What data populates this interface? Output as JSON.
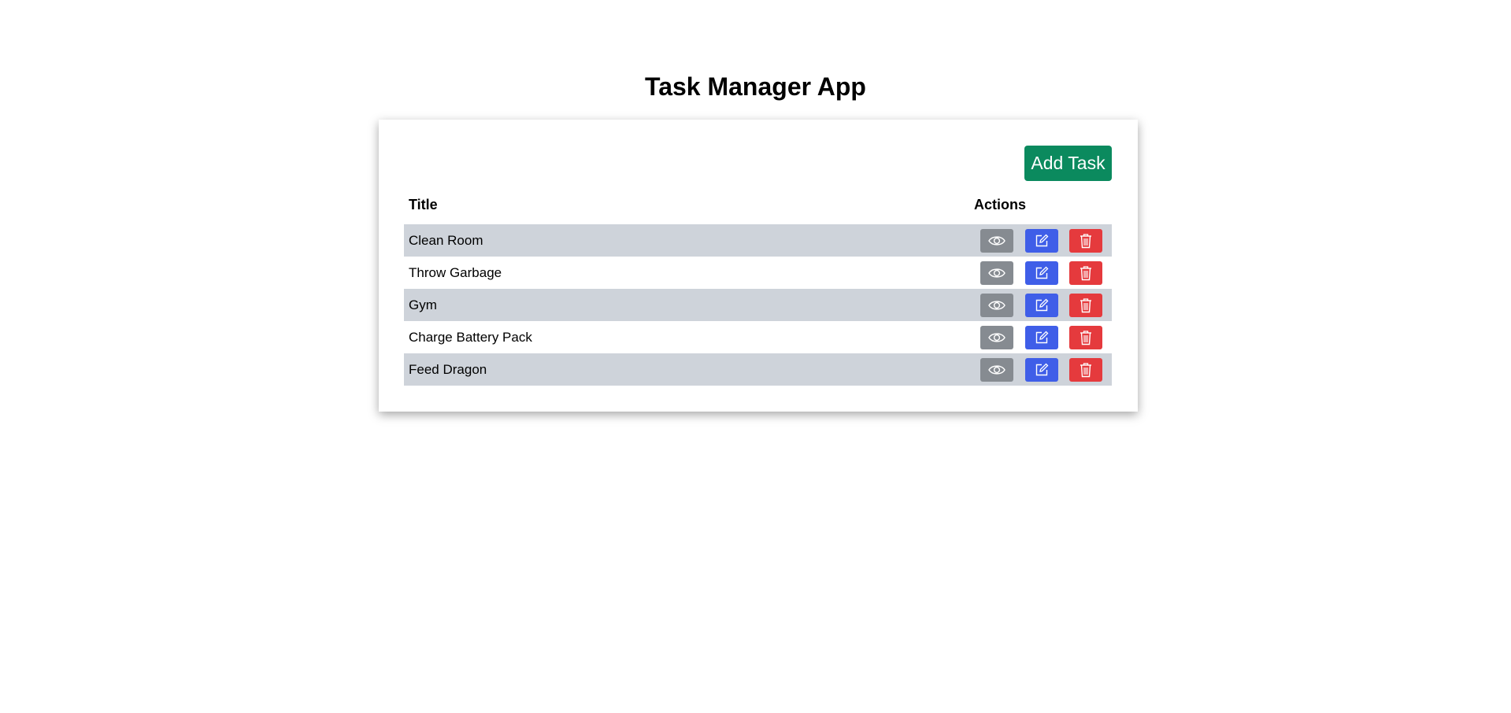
{
  "app": {
    "title": "Task Manager App"
  },
  "toolbar": {
    "add_label": "Add Task"
  },
  "table": {
    "columns": [
      "Title",
      "Actions"
    ],
    "rows": [
      {
        "title": "Clean Room"
      },
      {
        "title": "Throw Garbage"
      },
      {
        "title": "Gym"
      },
      {
        "title": "Charge Battery Pack"
      },
      {
        "title": "Feed Dragon"
      }
    ],
    "row_actions": [
      {
        "icon": "eye-icon",
        "color": "#868b91"
      },
      {
        "icon": "edit-icon",
        "color": "#3f5ee8"
      },
      {
        "icon": "trash-icon",
        "color": "#e53a3d"
      }
    ]
  },
  "colors": {
    "add_button": "#0b8a5e",
    "shaded_row": "#ced3da"
  }
}
